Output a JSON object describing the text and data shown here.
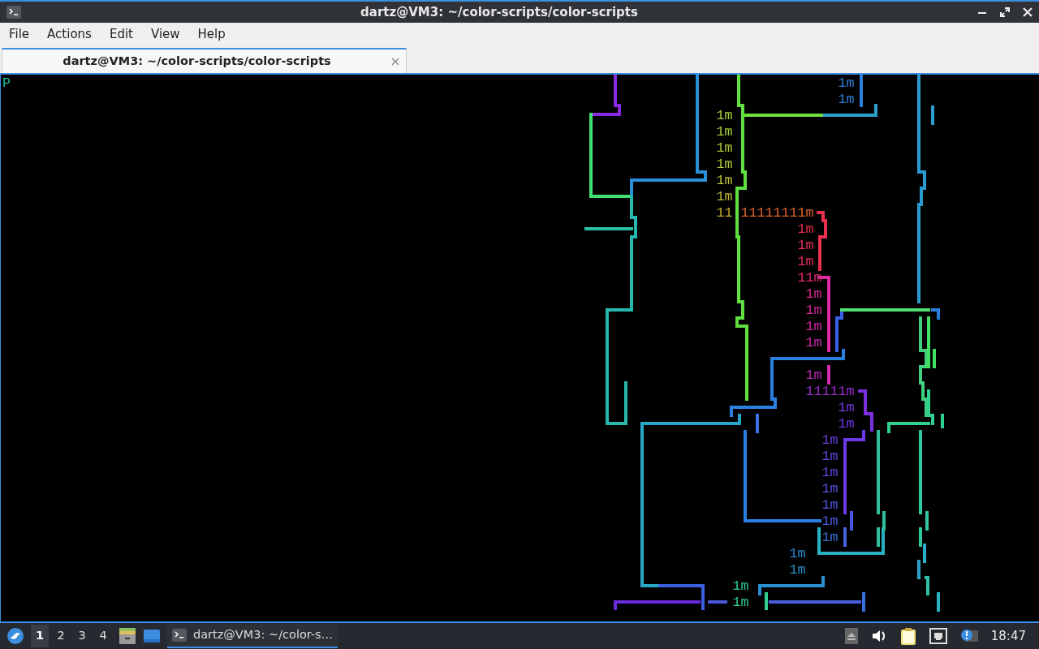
{
  "window": {
    "title": "dartz@VM3: ~/color-scripts/color-scripts"
  },
  "menu": [
    "File",
    "Actions",
    "Edit",
    "View",
    "Help"
  ],
  "tabs": [
    {
      "label": "dartz@VM3: ~/color-scripts/color-scripts",
      "selected": true
    }
  ],
  "terminal": {
    "lines": [
      [
        {
          "text": "P",
          "color": "#20c0a0"
        },
        {
          "text": "                                                                                                      1m",
          "color": "#2f7fd6"
        }
      ],
      [
        {
          "text": "                                                                                                       1m",
          "color": "#2f7fd6"
        }
      ],
      [
        {
          "text": "                                                                                        1m",
          "color": "#a8cc3a"
        }
      ],
      [
        {
          "text": "                                                                                        1m",
          "color": "#a8cc3a"
        }
      ],
      [
        {
          "text": "                                                                                        1m",
          "color": "#aec83a"
        }
      ],
      [
        {
          "text": "                                                                                        1m",
          "color": "#b4c43a"
        }
      ],
      [
        {
          "text": "                                                                                        1m",
          "color": "#bac036"
        }
      ],
      [
        {
          "text": "                                                                                        1m",
          "color": "#c0b834"
        }
      ],
      [
        {
          "text": "                                                                                        11",
          "color": "#c8b030"
        },
        {
          "text": " 11111111m",
          "color": "#e0642a"
        }
      ],
      [
        {
          "text": "                                                                                                  1m",
          "color": "#e83050"
        }
      ],
      [
        {
          "text": "                                                                                                  1m",
          "color": "#e83058"
        }
      ],
      [
        {
          "text": "                                                                                                  1m",
          "color": "#e62e60"
        }
      ],
      [
        {
          "text": "                                                                                                  11m",
          "color": "#e02a70"
        }
      ],
      [
        {
          "text": "                                                                                                   1m",
          "color": "#d82a90"
        }
      ],
      [
        {
          "text": "                                                                                                   1m",
          "color": "#d42a9c"
        }
      ],
      [
        {
          "text": "                                                                                                   1m",
          "color": "#d02aa8"
        }
      ],
      [
        {
          "text": "                                                                                                   1m",
          "color": "#c82ab0"
        }
      ],
      [
        {
          "text": "\n                                                                                                   1m",
          "color": "#b82ab8"
        }
      ],
      [
        {
          "text": "                                                                                                   11111m",
          "color": "#9a2ad0"
        }
      ],
      [
        {
          "text": "                                                                                                       1m",
          "color": "#7a3ae0"
        }
      ],
      [
        {
          "text": "                                                                                                       1m",
          "color": "#6a3ae8"
        }
      ],
      [
        {
          "text": "                                                                                                     1m",
          "color": "#6a40e0"
        }
      ],
      [
        {
          "text": "                                                                                                     1m",
          "color": "#5e46e0"
        }
      ],
      [
        {
          "text": "                                                                                                     1m",
          "color": "#5a48e0"
        }
      ],
      [
        {
          "text": "                                                                                                     1m",
          "color": "#5650e0"
        }
      ],
      [
        {
          "text": "                                                                                                     1m",
          "color": "#5058e0"
        }
      ],
      [
        {
          "text": "                                                                                                     1m",
          "color": "#4a60e0"
        }
      ],
      [
        {
          "text": "                                                                                                     1m",
          "color": "#3a70d8"
        }
      ],
      [
        {
          "text": "                                                                                                 1m",
          "color": "#2a8ad0"
        }
      ],
      [
        {
          "text": "                                                                                                 1m",
          "color": "#2a90c8"
        }
      ],
      [
        {
          "text": "                                                                                          1m",
          "color": "#30d0a0"
        }
      ],
      [
        {
          "text": "                                                                                          1m",
          "color": "#30d090"
        }
      ]
    ]
  },
  "taskbar": {
    "workspaces": [
      {
        "label": "1",
        "selected": true
      },
      {
        "label": "2",
        "selected": false
      },
      {
        "label": "3",
        "selected": false
      },
      {
        "label": "4",
        "selected": false
      }
    ],
    "tasks": [
      {
        "label": "dartz@VM3: ~/color-s…",
        "selected": true
      }
    ],
    "clock": "18:47"
  }
}
